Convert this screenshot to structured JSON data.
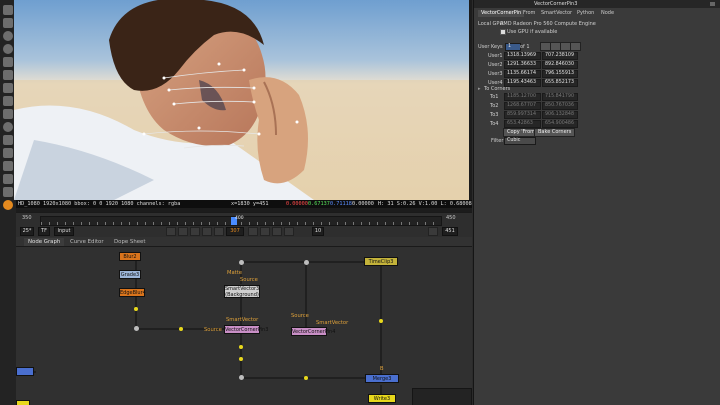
{
  "viewer": {
    "info_left": "HD_1080 1920x1080  bbox: 0 0 1920 1080 channels: rgba",
    "coords": "x=1830 y=451",
    "r": "0.00000",
    "g": "0.67137",
    "b": "0.71118",
    "a": "0.00000",
    "hsv": "H: 31 S:0.26 V:1.00  L: 0.68008"
  },
  "timeline": {
    "start": "350",
    "end": "450",
    "tick_mid": "400",
    "fps_value": "25*",
    "tf_value": "TF",
    "input_label": "Input",
    "frame": "307",
    "step": "10",
    "end_frame": "451"
  },
  "graph": {
    "tabs": [
      "Node Graph",
      "Curve Editor",
      "Dope Sheet"
    ],
    "nodes": {
      "blur": "Blur2",
      "grade": "Grade3",
      "edgeblur": "EdgeBlur4",
      "smartvector": "SmartVector3",
      "smartvector_sub": "(Background)",
      "timeclip": "TimeClip3",
      "vcp1": "VectorCornerPin3",
      "vcp2": "VectorCornerPin4",
      "merge": "Merge3",
      "write": "Write3"
    },
    "labels": {
      "matte": "Matte",
      "source1": "Source",
      "source2": "Source",
      "smartvector1": "SmartVector",
      "smartvector2": "SmartVector",
      "source3": "Source",
      "bg": "B"
    }
  },
  "panel": {
    "title": "VectorCornerPin3",
    "tabs": [
      "VectorCornerPin",
      "From",
      "SmartVector",
      "Python",
      "Node"
    ],
    "gpu_label": "Local GPU:",
    "gpu_value": "AMD Radeon Pro 560 Compute Engine",
    "use_gpu": "Use GPU if available",
    "user_keys_label": "User Keys",
    "user_keys_count": "1",
    "user_keys_of": "of 1",
    "users": [
      {
        "label": "User1",
        "x": "1318.13969",
        "y": "707.238109"
      },
      {
        "label": "User2",
        "x": "1291.36633",
        "y": "892.846030"
      },
      {
        "label": "User3",
        "x": "1135.66174",
        "y": "796.155913"
      },
      {
        "label": "User4",
        "x": "1195.43463",
        "y": "655.852173"
      }
    ],
    "to_corners": "To Corners",
    "to_rows": [
      {
        "label": "To1",
        "x": "1185.12700",
        "y": "715.841790"
      },
      {
        "label": "To2",
        "x": "1268.67707",
        "y": "850.767036"
      },
      {
        "label": "To3",
        "x": "859.997314",
        "y": "906.132848"
      },
      {
        "label": "To4",
        "x": "653.42863",
        "y": "654.900486"
      }
    ],
    "copy_from": "Copy 'From'",
    "bake_corners": "Bake Corners",
    "filter_label": "Filter",
    "filter_value": "Cubic"
  }
}
